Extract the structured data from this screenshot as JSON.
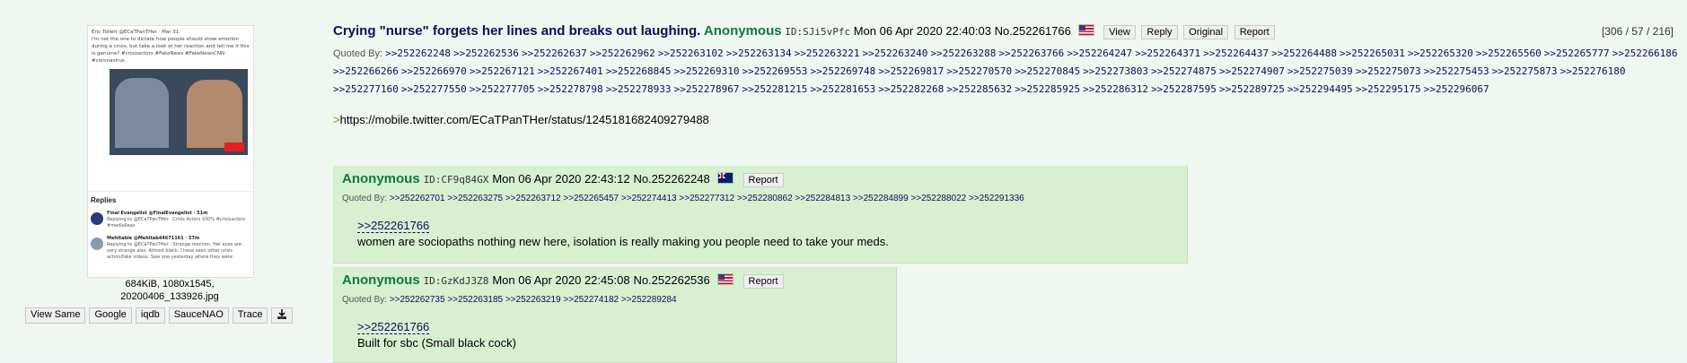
{
  "thumbnail": {
    "tweet_header": "Eric Tollett @ECaTPanTHer · Mar 31",
    "tweet_text": "I'm not the one to dictate how people should show emotion during a crisis, but take a look at her reaction and tell me if this is genuine? #crisisactors #FakeNews #FakeNewsCNN #coronavirus",
    "replies_header": "Replies",
    "reply1_head": "Final Evangelist @FinalEvangelist · 51m",
    "reply1_text": "Replying to @ECaTPanTHer · Crisis Actors 100% #crisisactors #medialleas",
    "reply2_head": "Mehitable @Mehitab44671161 · 57m",
    "reply2_text": "Replying to @ECaTPanTHer · Strange reaction. Her eyes are very strange also. Almost black. I have seen other crisis actors/fake videos. Saw one yesterday where they were"
  },
  "file": {
    "size_dims": "684KiB, 1080x1545,",
    "filename": "20200406_133926.jpg"
  },
  "image_search_buttons": [
    "View Same",
    "Google",
    "iqdb",
    "SauceNAO",
    "Trace"
  ],
  "download_icon": "download-icon",
  "op": {
    "subject": "Crying \"nurse\" forgets her lines and breaks out laughing.",
    "name": "Anonymous",
    "id": "ID:SJi5vPfc",
    "datetime": "Mon 06 Apr 2020 22:40:03",
    "post_no": "No.252261766",
    "flag": "US",
    "buttons": [
      "View",
      "Reply",
      "Original",
      "Report"
    ],
    "counter": "[306 / 57 / 216]",
    "quoted_by_label": "Quoted By:",
    "quoted_by": [
      ">>252262248",
      ">>252262536",
      ">>252262637",
      ">>252262962",
      ">>252263102",
      ">>252263134",
      ">>252263221",
      ">>252263240",
      ">>252263288",
      ">>252263766",
      ">>252264247",
      ">>252264371",
      ">>252264437",
      ">>252264488",
      ">>252265031",
      ">>252265320",
      ">>252265560",
      ">>252265777",
      ">>252266186",
      ">>252266266",
      ">>252266970",
      ">>252267121",
      ">>252267401",
      ">>252268845",
      ">>252269310",
      ">>252269553",
      ">>252269748",
      ">>252269817",
      ">>252270570",
      ">>252270845",
      ">>252273803",
      ">>252274875",
      ">>252274907",
      ">>252275039",
      ">>252275073",
      ">>252275453",
      ">>252275873",
      ">>252276180",
      ">>252277160",
      ">>252277550",
      ">>252277705",
      ">>252278798",
      ">>252278933",
      ">>252278967",
      ">>252281215",
      ">>252281653",
      ">>252282268",
      ">>252285632",
      ">>252285925",
      ">>252286312",
      ">>252287595",
      ">>252289725",
      ">>252294495",
      ">>252295175",
      ">>252296067"
    ],
    "body_quote_marker": ">",
    "body_url": "https://mobile.twitter.com/ECaTPanTHer/status/1245181682409279488"
  },
  "replies": [
    {
      "name": "Anonymous",
      "id": "ID:CF9q84GX",
      "datetime": "Mon 06 Apr 2020 22:43:12",
      "post_no": "No.252262248",
      "flag": "AU",
      "report": "Report",
      "quoted_by_label": "Quoted By:",
      "quoted_by": [
        ">>252262701",
        ">>252263275",
        ">>252263712",
        ">>252265457",
        ">>252274413",
        ">>252277312",
        ">>252280862",
        ">>252284813",
        ">>252284899",
        ">>252288022",
        ">>252291336"
      ],
      "quotelink": ">>252261766",
      "text": "women are sociopaths nothing new here, isolation is really making you people need to take your meds."
    },
    {
      "name": "Anonymous",
      "id": "ID:GzKdJ3Z8",
      "datetime": "Mon 06 Apr 2020 22:45:08",
      "post_no": "No.252262536",
      "flag": "US",
      "report": "Report",
      "quoted_by_label": "Quoted By:",
      "quoted_by": [
        ">>252262735",
        ">>252263185",
        ">>252263219",
        ">>252274182",
        ">>252289284"
      ],
      "quotelink": ">>252261766",
      "text": "Built for sbc (Small black cock)"
    }
  ]
}
